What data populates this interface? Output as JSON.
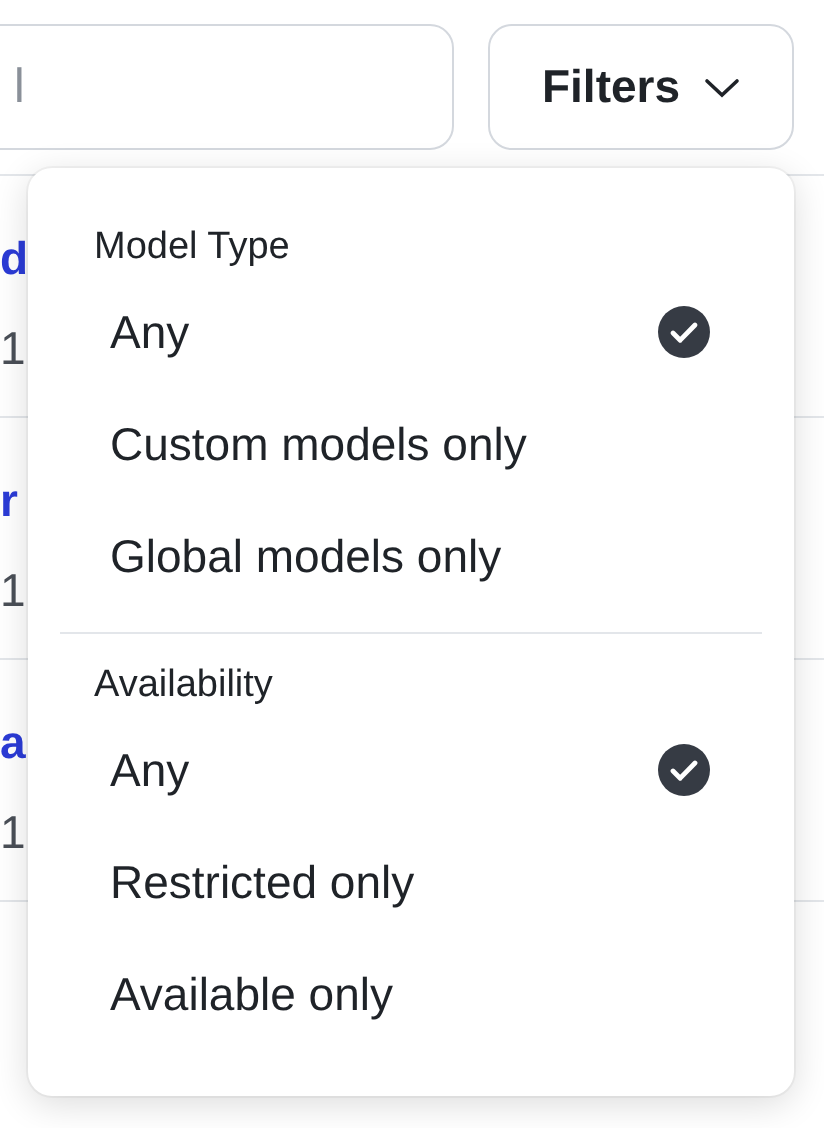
{
  "search": {
    "placeholder": "l"
  },
  "filter_button": {
    "label": "Filters"
  },
  "rows": [
    {
      "link": "d",
      "value": "1"
    },
    {
      "link": "r",
      "value": "1"
    },
    {
      "link": "a",
      "value": "1"
    }
  ],
  "menu": {
    "sections": [
      {
        "title": "Model Type",
        "options": [
          {
            "label": "Any",
            "selected": true
          },
          {
            "label": "Custom models only",
            "selected": false
          },
          {
            "label": "Global models only",
            "selected": false
          }
        ]
      },
      {
        "title": "Availability",
        "options": [
          {
            "label": "Any",
            "selected": true
          },
          {
            "label": "Restricted only",
            "selected": false
          },
          {
            "label": "Available only",
            "selected": false
          }
        ]
      }
    ]
  }
}
